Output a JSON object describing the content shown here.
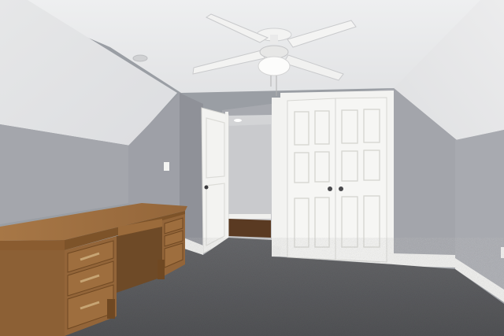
{
  "scene": {
    "colors": {
      "ceiling": "#e9eaeb",
      "wall": "#a6a8ae",
      "wall_dark": "#8f9198",
      "trim": "#f4f4f2",
      "carpet": "#5c5d60",
      "desk_wood": "#9a6c3c",
      "desk_dark": "#7a522a",
      "hall_floor": "#5a3a22"
    },
    "objects": [
      "ceiling-fan",
      "closet-double-door",
      "open-door",
      "wooden-desk",
      "hallway",
      "carpet"
    ]
  }
}
